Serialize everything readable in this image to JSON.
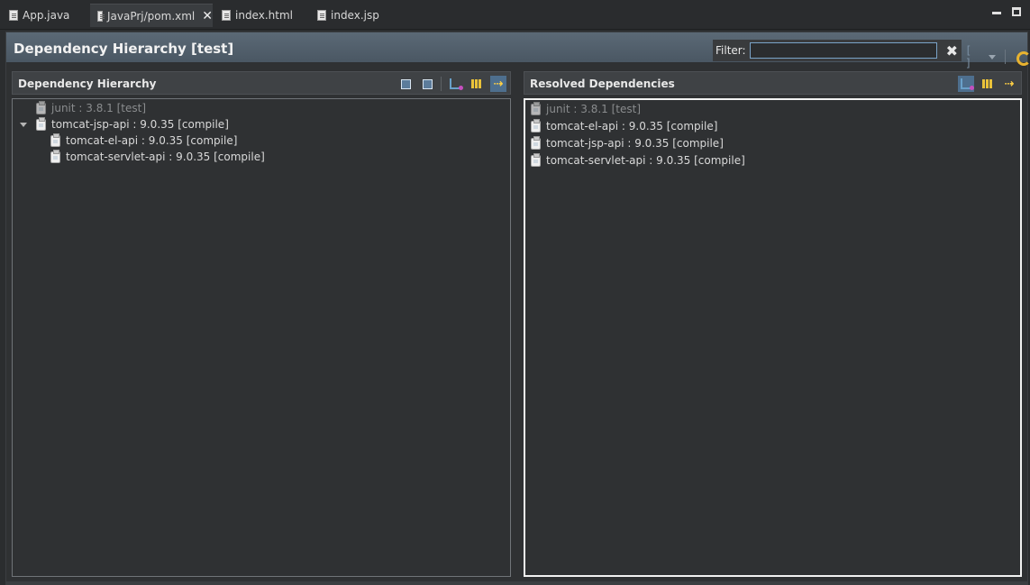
{
  "tabs": [
    {
      "label": "App.java",
      "active": false
    },
    {
      "label": "JavaPrj/pom.xml",
      "active": true
    },
    {
      "label": "index.html",
      "active": false
    },
    {
      "label": "index.jsp",
      "active": false
    }
  ],
  "editor": {
    "title": "Dependency Hierarchy [test]",
    "filter": {
      "label": "Filter:",
      "value": "",
      "placeholder": ""
    }
  },
  "left_panel": {
    "title": "Dependency Hierarchy",
    "items": [
      {
        "label": "junit : 3.8.1 [test]",
        "dimmed": true
      },
      {
        "label": "tomcat-jsp-api : 9.0.35 [compile]",
        "expanded": true
      },
      {
        "label": "tomcat-el-api : 9.0.35 [compile]"
      },
      {
        "label": "tomcat-servlet-api : 9.0.35 [compile]"
      }
    ]
  },
  "right_panel": {
    "title": "Resolved Dependencies",
    "items": [
      {
        "label": "junit : 3.8.1 [test]",
        "dimmed": true
      },
      {
        "label": "tomcat-el-api : 9.0.35 [compile]"
      },
      {
        "label": "tomcat-jsp-api : 9.0.35 [compile]"
      },
      {
        "label": "tomcat-servlet-api : 9.0.35 [compile]"
      }
    ]
  },
  "colors": {
    "header_bg": "#52606d",
    "accent_yellow": "#e9c23a",
    "selected_tool_bg": "#4e6f8e"
  }
}
